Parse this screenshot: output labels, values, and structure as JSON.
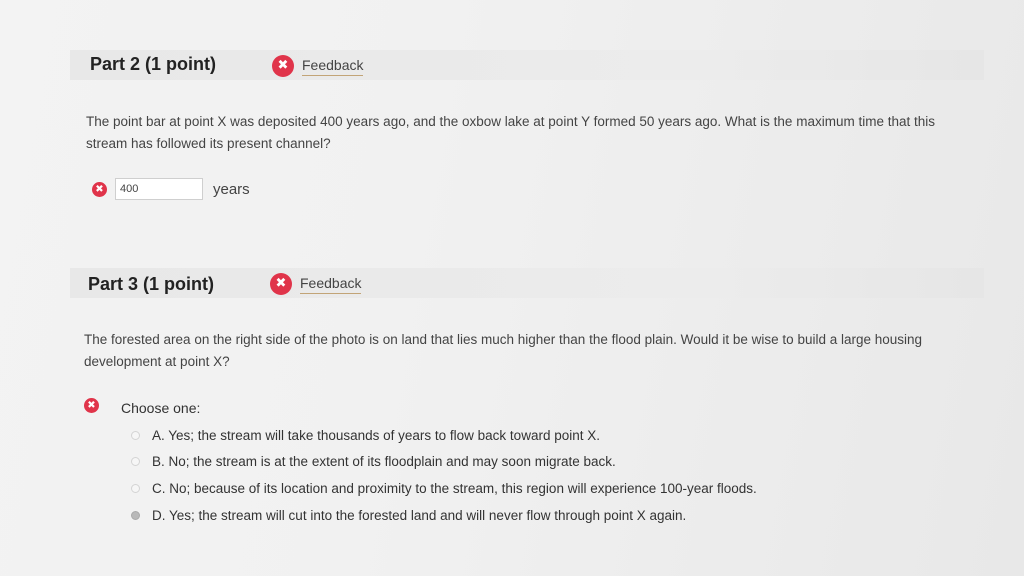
{
  "part2": {
    "title": "Part 2   (1 point)",
    "feedback_label": "Feedback",
    "question": "The point bar at point X was deposited 400 years ago, and the oxbow lake at point Y formed 50 years ago. What is the maximum time that this stream has followed its present channel?",
    "answer_value": "400",
    "units": "years"
  },
  "part3": {
    "title": "Part 3   (1 point)",
    "feedback_label": "Feedback",
    "question": "The forested area on the right side of the photo is on land that lies much higher than the flood plain. Would it be wise to build a large housing development at point X?",
    "choose_label": "Choose one:",
    "options": [
      {
        "label": "A. Yes; the stream will take thousands of years to flow back toward point X.",
        "selected": false
      },
      {
        "label": "B. No; the stream is at the extent of its floodplain and may soon migrate back.",
        "selected": false
      },
      {
        "label": "C. No; because of its location and proximity to the stream, this region will experience 100-year floods.",
        "selected": false
      },
      {
        "label": "D. Yes; the stream will cut into the forested land and will never flow through point X again.",
        "selected": true
      }
    ]
  },
  "icons": {
    "incorrect": "x-circle-icon"
  },
  "colors": {
    "incorrect": "#e0344a",
    "feedback_underline": "#c2a477"
  }
}
